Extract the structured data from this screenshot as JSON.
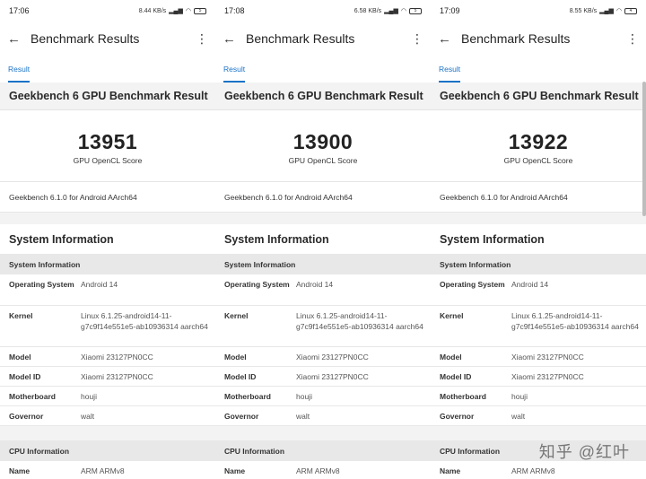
{
  "panels": [
    {
      "status": {
        "time": "17:06",
        "net": "8.44 KB/s",
        "battery": "5"
      },
      "app": {
        "title": "Benchmark Results"
      },
      "tab": "Result",
      "header": "Geekbench 6 GPU Benchmark Result",
      "score": "13951",
      "score_label": "GPU OpenCL Score",
      "version": "Geekbench 6.1.0 for Android AArch64",
      "sys_title": "System Information",
      "sys_sub": "System Information",
      "os_key": "Operating System",
      "os_val": "Android 14",
      "kernel_key": "Kernel",
      "kernel_val": "Linux 6.1.25-android14-11-g7c9f14e551e5-ab10936314 aarch64",
      "model_key": "Model",
      "model_val": "Xiaomi 23127PN0CC",
      "modelid_key": "Model ID",
      "modelid_val": "Xiaomi 23127PN0CC",
      "mb_key": "Motherboard",
      "mb_val": "houji",
      "gov_key": "Governor",
      "gov_val": "walt",
      "cpu_sub": "CPU Information",
      "name_key": "Name",
      "name_val": "ARM ARMv8"
    },
    {
      "status": {
        "time": "17:08",
        "net": "6.58 KB/s",
        "battery": "5"
      },
      "app": {
        "title": "Benchmark Results"
      },
      "tab": "Result",
      "header": "Geekbench 6 GPU Benchmark Result",
      "score": "13900",
      "score_label": "GPU OpenCL Score",
      "version": "Geekbench 6.1.0 for Android AArch64",
      "sys_title": "System Information",
      "sys_sub": "System Information",
      "os_key": "Operating System",
      "os_val": "Android 14",
      "kernel_key": "Kernel",
      "kernel_val": "Linux 6.1.25-android14-11-g7c9f14e551e5-ab10936314 aarch64",
      "model_key": "Model",
      "model_val": "Xiaomi 23127PN0CC",
      "modelid_key": "Model ID",
      "modelid_val": "Xiaomi 23127PN0CC",
      "mb_key": "Motherboard",
      "mb_val": "houji",
      "gov_key": "Governor",
      "gov_val": "walt",
      "cpu_sub": "CPU Information",
      "name_key": "Name",
      "name_val": "ARM ARMv8"
    },
    {
      "status": {
        "time": "17:09",
        "net": "8.55 KB/s",
        "battery": "4"
      },
      "app": {
        "title": "Benchmark Results"
      },
      "tab": "Result",
      "header": "Geekbench 6 GPU Benchmark Result",
      "score": "13922",
      "score_label": "GPU OpenCL Score",
      "version": "Geekbench 6.1.0 for Android AArch64",
      "sys_title": "System Information",
      "sys_sub": "System Information",
      "os_key": "Operating System",
      "os_val": "Android 14",
      "kernel_key": "Kernel",
      "kernel_val": "Linux 6.1.25-android14-11-g7c9f14e551e5-ab10936314 aarch64",
      "model_key": "Model",
      "model_val": "Xiaomi 23127PN0CC",
      "modelid_key": "Model ID",
      "modelid_val": "Xiaomi 23127PN0CC",
      "mb_key": "Motherboard",
      "mb_val": "houji",
      "gov_key": "Governor",
      "gov_val": "walt",
      "cpu_sub": "CPU Information",
      "name_key": "Name",
      "name_val": "ARM ARMv8"
    }
  ],
  "icons": {
    "back": "arrow-left-icon",
    "more": "more-vertical-icon"
  },
  "watermark": "知乎 @红叶",
  "colors": {
    "accent": "#1a73c8",
    "header_bg": "#f3f3f3",
    "subheader_bg": "#e8e8e8"
  }
}
